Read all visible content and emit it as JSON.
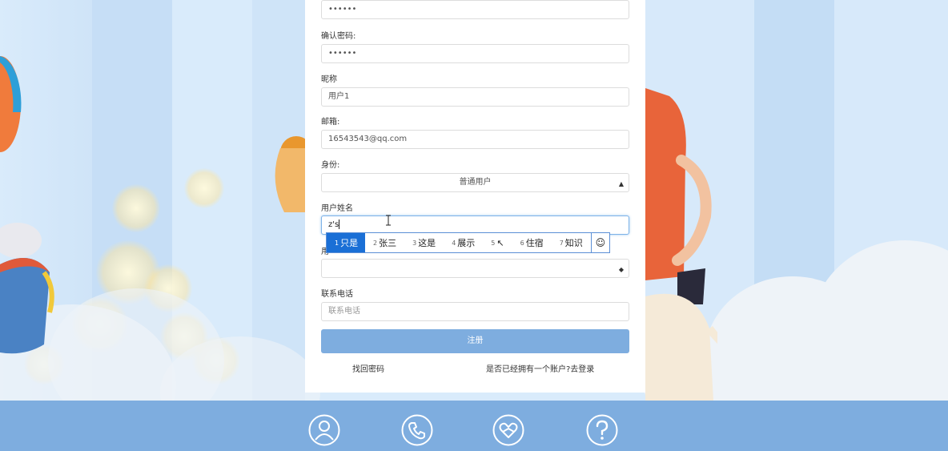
{
  "form": {
    "password_value": "••••••",
    "confirm_label": "确认密码:",
    "confirm_value": "••••••",
    "nickname_label": "昵称",
    "nickname_value": "用户1",
    "email_label": "邮箱:",
    "email_value": "16543543@qq.com",
    "role_label": "身份:",
    "role_selected": "普通用户",
    "realname_label": "用户姓名",
    "realname_value": "z's",
    "hidden_label_fragment": "用",
    "phone_label": "联系电话",
    "phone_placeholder": "联系电话",
    "submit_label": "注册",
    "forgot_link": "找回密码",
    "login_link": "是否已经拥有一个账户?去登录"
  },
  "ime": {
    "candidates": [
      {
        "num": "1",
        "text": "只是"
      },
      {
        "num": "2",
        "text": "张三"
      },
      {
        "num": "3",
        "text": "这是"
      },
      {
        "num": "4",
        "text": "展示"
      },
      {
        "num": "5",
        "text": "↖"
      },
      {
        "num": "6",
        "text": "住宿"
      },
      {
        "num": "7",
        "text": "知识"
      }
    ],
    "emoji": "☺"
  },
  "footer": {
    "icons": [
      "user-icon",
      "phone-icon",
      "heart-icon",
      "help-icon"
    ]
  },
  "colors": {
    "accent": "#7eaddf",
    "ime_active": "#1a6fd6",
    "background": "#d6e9fb"
  }
}
